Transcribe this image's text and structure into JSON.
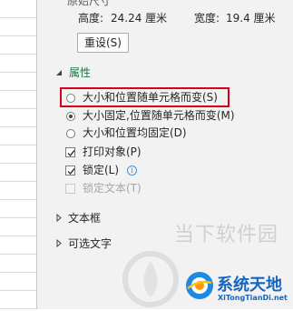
{
  "original_size": {
    "heading": "原始尺寸",
    "height_label": "高度:",
    "height_value": "24.24 厘米",
    "width_label": "宽度:",
    "width_value": "19.4 厘米",
    "reset_button": "重设(S)"
  },
  "properties": {
    "title": "属性",
    "options": [
      {
        "label": "大小和位置随单元格而变(S)",
        "checked": false
      },
      {
        "label": "大小固定,位置随单元格而变(M)",
        "checked": true
      },
      {
        "label": "大小和位置均固定(D)",
        "checked": false
      }
    ],
    "print_object": "打印对象(P)",
    "locked": "锁定(L)",
    "lock_text": "锁定文本(T)"
  },
  "sections": {
    "textbox": "文本框",
    "alt_text": "可选文字"
  },
  "watermark": {
    "site_text": "当下软件园",
    "brand_cn": "系统天地",
    "brand_en": "XiTongTianDi.net"
  },
  "colors": {
    "accent": "#217346",
    "highlight": "#d9001b",
    "brand": "#1565c0"
  }
}
